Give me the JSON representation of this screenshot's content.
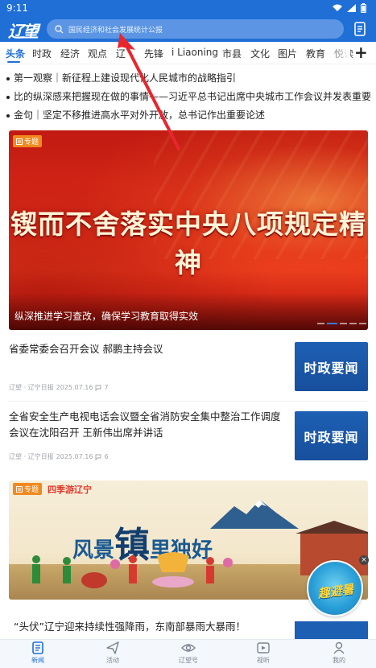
{
  "status_bar": {
    "time": "9:11"
  },
  "header": {
    "logo_text": "辽望",
    "search": {
      "placeholder": "国民经济和社会发展统计公报"
    }
  },
  "tabs": [
    {
      "label": "头条",
      "active": true
    },
    {
      "label": "时政"
    },
    {
      "label": "经济"
    },
    {
      "label": "观点"
    },
    {
      "label": "辽"
    },
    {
      "label": "先锋"
    },
    {
      "label": "i Liaoning"
    },
    {
      "label": "市县"
    },
    {
      "label": "文化"
    },
    {
      "label": "图片"
    },
    {
      "label": "教育"
    },
    {
      "label": "悦读"
    }
  ],
  "headlines": [
    {
      "text": "第一观察｜新征程上建设现代化人民城市的战略指引"
    },
    {
      "text": "比的纵深感来把握现在做的事情——习近平总书记出席中央城市工作会议并发表重要"
    },
    {
      "text": "金句｜坚定不移推进高水平对外开放，总书记作出重要论述"
    }
  ],
  "banner": {
    "badge": "专题",
    "headline": "锲而不舍落实中央八项规定精神",
    "caption": "纵深推进学习查改，确保学习教育取得实效"
  },
  "news": [
    {
      "title": "省委常委会召开会议 郝鹏主持会议",
      "source": "辽望 · 辽宁日报",
      "date": "2025.07.16",
      "comments": "7",
      "thumb_text": "时政要闻"
    },
    {
      "title": "全省安全生产电视电话会议暨全省消防安全集中整治工作调度会议在沈阳召开 王新伟出席并讲话",
      "source": "辽望 · 辽宁日报",
      "date": "2025.07.16",
      "comments": "6",
      "thumb_text": "时政要闻"
    }
  ],
  "tourism": {
    "badge": "专题",
    "label": "四季游辽宁",
    "part1": "风景",
    "big": "镇",
    "part2": "里独好"
  },
  "promo": {
    "text": "趣避暑"
  },
  "last_headline": "“头伏”辽宁迎来持续性强降雨，东南部暴雨大暴雨！",
  "bottom_nav": [
    {
      "label": "新闻",
      "active": true
    },
    {
      "label": "活动"
    },
    {
      "label": "辽望号"
    },
    {
      "label": "视听"
    },
    {
      "label": "我的"
    }
  ],
  "colors": {
    "brand": "#1f6fd6",
    "banner_red": "#d92a18",
    "badge_orange": "#f08a1e",
    "thumb_blue": "#1d5fb3"
  }
}
